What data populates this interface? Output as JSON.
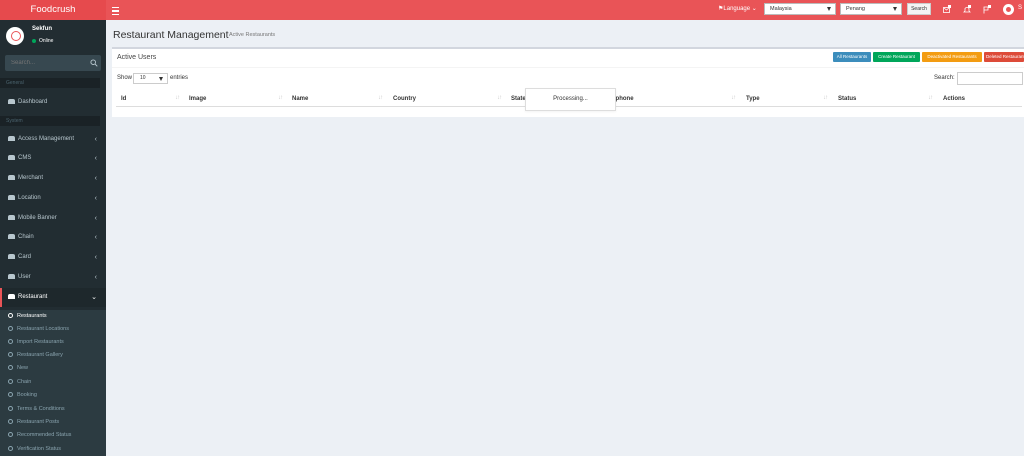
{
  "header": {
    "logo": "Foodcrush",
    "language_label": "Language",
    "country_select": "Malaysia",
    "state_select": "Penang",
    "search_button": "Search",
    "user_initial": "S"
  },
  "sidebar": {
    "user_name": "Sekfun",
    "user_status": "Online",
    "search_placeholder": "Search...",
    "section_general": "General",
    "section_system": "System",
    "items": [
      {
        "label": "Dashboard",
        "icon": "dashboard-icon"
      },
      {
        "label": "Access Management",
        "icon": "users-icon"
      },
      {
        "label": "CMS",
        "icon": "users-icon"
      },
      {
        "label": "Merchant",
        "icon": "users-icon"
      },
      {
        "label": "Location",
        "icon": "users-icon"
      },
      {
        "label": "Mobile Banner",
        "icon": "users-icon"
      },
      {
        "label": "Chain",
        "icon": "users-icon"
      },
      {
        "label": "Card",
        "icon": "users-icon"
      },
      {
        "label": "User",
        "icon": "users-icon"
      },
      {
        "label": "Restaurant",
        "icon": "users-icon"
      }
    ],
    "submenu": [
      "Restaurants",
      "Restaurant Locations",
      "Import Restaurants",
      "Restaurant Gallery",
      "New",
      "Chain",
      "Booking",
      "Terms & Conditions",
      "Restaurant Posts",
      "Recommended Status",
      "Verification Status"
    ]
  },
  "page": {
    "title": "Restaurant Management",
    "subtitle": "Active Restaurants"
  },
  "box": {
    "title": "Active Users",
    "buttons": [
      {
        "label": "All Restaurants",
        "color": "#3c8dbc"
      },
      {
        "label": "Create Restaurant",
        "color": "#00a65a"
      },
      {
        "label": "Deactivated Restaurants",
        "color": "#f39c12"
      },
      {
        "label": "Deleted Restaurants",
        "color": "#dd4b39"
      }
    ],
    "show_label": "Show",
    "length_value": "10",
    "entries_label": "entries",
    "search_label": "Search:",
    "columns": [
      "Id",
      "Image",
      "Name",
      "Country",
      "State",
      "Telephone",
      "Type",
      "Status",
      "Actions"
    ],
    "processing": "Processing..."
  },
  "colors": {
    "header": "#e95457",
    "sidebar": "#222d32",
    "active_accent": "#e95457"
  }
}
